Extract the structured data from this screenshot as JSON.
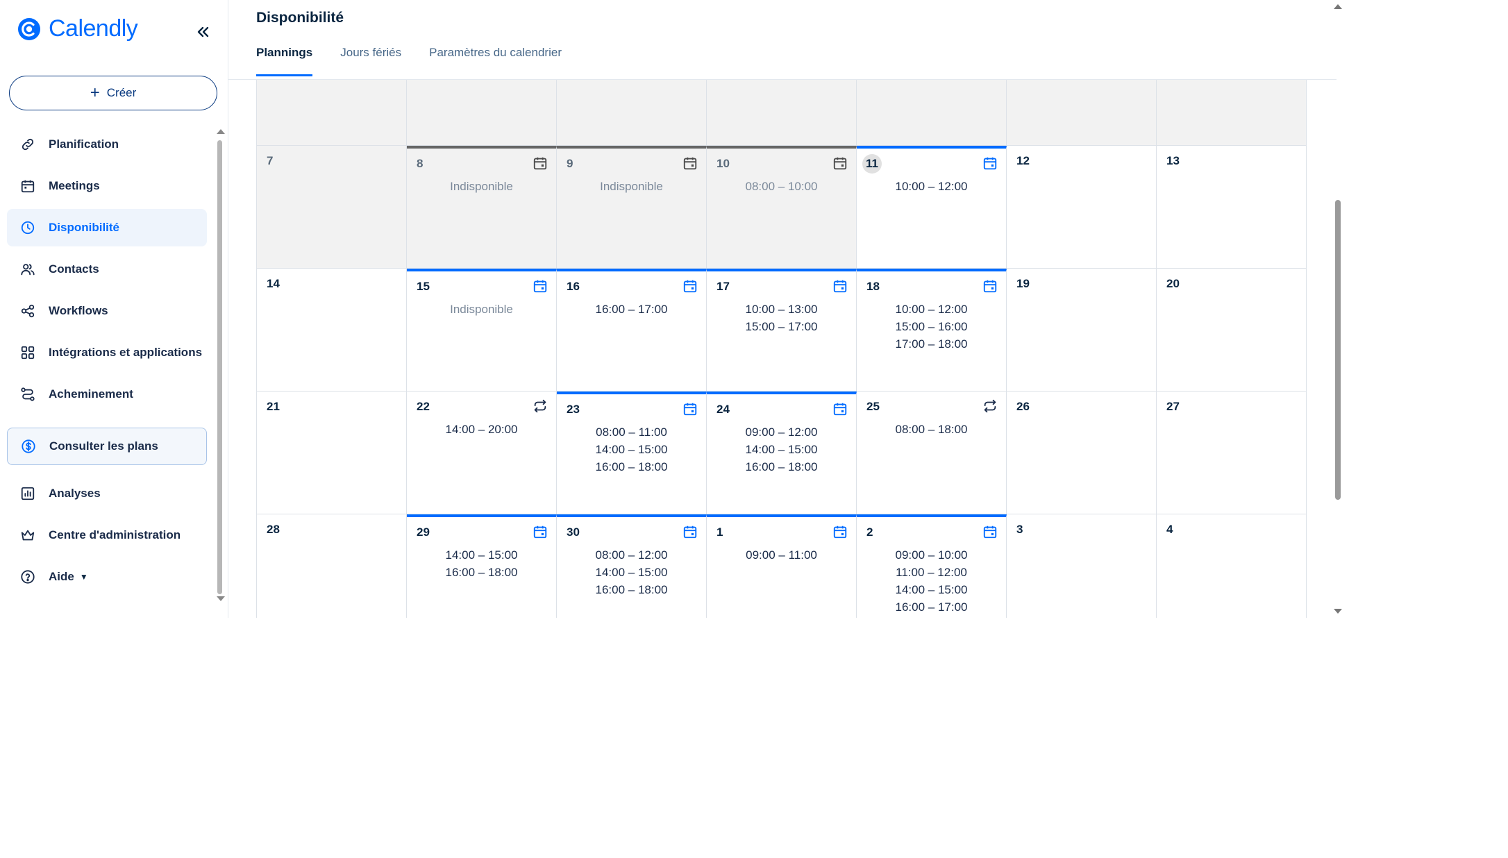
{
  "brand": {
    "name": "Calendly",
    "color": "#006bff"
  },
  "sidebar": {
    "create_label": "Créer",
    "items": [
      {
        "label": "Planification",
        "icon": "link-icon",
        "active": false
      },
      {
        "label": "Meetings",
        "icon": "calendar-icon",
        "active": false
      },
      {
        "label": "Disponibilité",
        "icon": "clock-icon",
        "active": true
      },
      {
        "label": "Contacts",
        "icon": "contacts-icon",
        "active": false
      },
      {
        "label": "Workflows",
        "icon": "workflow-icon",
        "active": false
      },
      {
        "label": "Intégrations et applications",
        "icon": "grid-icon",
        "active": false
      },
      {
        "label": "Acheminement",
        "icon": "routing-icon",
        "active": false
      },
      {
        "label": "Consulter les plans",
        "icon": "dollar-icon",
        "active": false
      },
      {
        "label": "Analyses",
        "icon": "chart-icon",
        "active": false
      },
      {
        "label": "Centre d'administration",
        "icon": "crown-icon",
        "active": false
      },
      {
        "label": "Aide",
        "icon": "help-icon",
        "active": false
      }
    ]
  },
  "header": {
    "title": "Disponibilité",
    "tabs": [
      {
        "label": "Plannings",
        "active": true
      },
      {
        "label": "Jours fériés",
        "active": false
      },
      {
        "label": "Paramètres du calendrier",
        "active": false
      }
    ]
  },
  "calendar": {
    "weeks": [
      [
        {
          "day": "7",
          "greyed": true,
          "times": []
        },
        {
          "day": "8",
          "greyed": true,
          "icon": "calendar-date-icon",
          "times": [
            "Indisponible"
          ],
          "muted": true
        },
        {
          "day": "9",
          "greyed": true,
          "icon": "calendar-date-icon",
          "times": [
            "Indisponible"
          ],
          "muted": true
        },
        {
          "day": "10",
          "greyed": true,
          "icon": "calendar-date-icon",
          "times": [
            "08:00 – 10:00"
          ],
          "muted": true
        },
        {
          "day": "11",
          "today": true,
          "icon": "calendar-date-icon",
          "times": [
            "10:00 – 12:00"
          ]
        },
        {
          "day": "12",
          "times": []
        },
        {
          "day": "13",
          "times": []
        }
      ],
      [
        {
          "day": "14",
          "times": []
        },
        {
          "day": "15",
          "icon": "calendar-date-icon",
          "times": [
            "Indisponible"
          ],
          "muted": true
        },
        {
          "day": "16",
          "icon": "calendar-date-icon",
          "times": [
            "16:00 – 17:00"
          ]
        },
        {
          "day": "17",
          "icon": "calendar-date-icon",
          "times": [
            "10:00 – 13:00",
            "15:00 – 17:00"
          ]
        },
        {
          "day": "18",
          "icon": "calendar-date-icon",
          "times": [
            "10:00 – 12:00",
            "15:00 – 16:00",
            "17:00 – 18:00"
          ]
        },
        {
          "day": "19",
          "times": []
        },
        {
          "day": "20",
          "times": []
        }
      ],
      [
        {
          "day": "21",
          "times": []
        },
        {
          "day": "22",
          "icon": "repeat-icon",
          "times": [
            "14:00 – 20:00"
          ]
        },
        {
          "day": "23",
          "icon": "calendar-date-icon",
          "times": [
            "08:00 – 11:00",
            "14:00 – 15:00",
            "16:00 – 18:00"
          ]
        },
        {
          "day": "24",
          "icon": "calendar-date-icon",
          "times": [
            "09:00 – 12:00",
            "14:00 – 15:00",
            "16:00 – 18:00"
          ]
        },
        {
          "day": "25",
          "icon": "repeat-icon",
          "times": [
            "08:00 – 18:00"
          ]
        },
        {
          "day": "26",
          "times": []
        },
        {
          "day": "27",
          "times": []
        }
      ],
      [
        {
          "day": "28",
          "times": []
        },
        {
          "day": "29",
          "icon": "calendar-date-icon",
          "times": [
            "14:00 – 15:00",
            "16:00 – 18:00"
          ]
        },
        {
          "day": "30",
          "icon": "calendar-date-icon",
          "times": [
            "08:00 – 12:00",
            "14:00 – 15:00",
            "16:00 – 18:00"
          ]
        },
        {
          "day": "1",
          "icon": "calendar-date-icon",
          "times": [
            "09:00 – 11:00"
          ]
        },
        {
          "day": "2",
          "icon": "calendar-date-icon",
          "times": [
            "09:00 – 10:00",
            "11:00 – 12:00",
            "14:00 – 15:00",
            "16:00 – 17:00"
          ]
        },
        {
          "day": "3",
          "times": []
        },
        {
          "day": "4",
          "times": []
        }
      ]
    ]
  }
}
